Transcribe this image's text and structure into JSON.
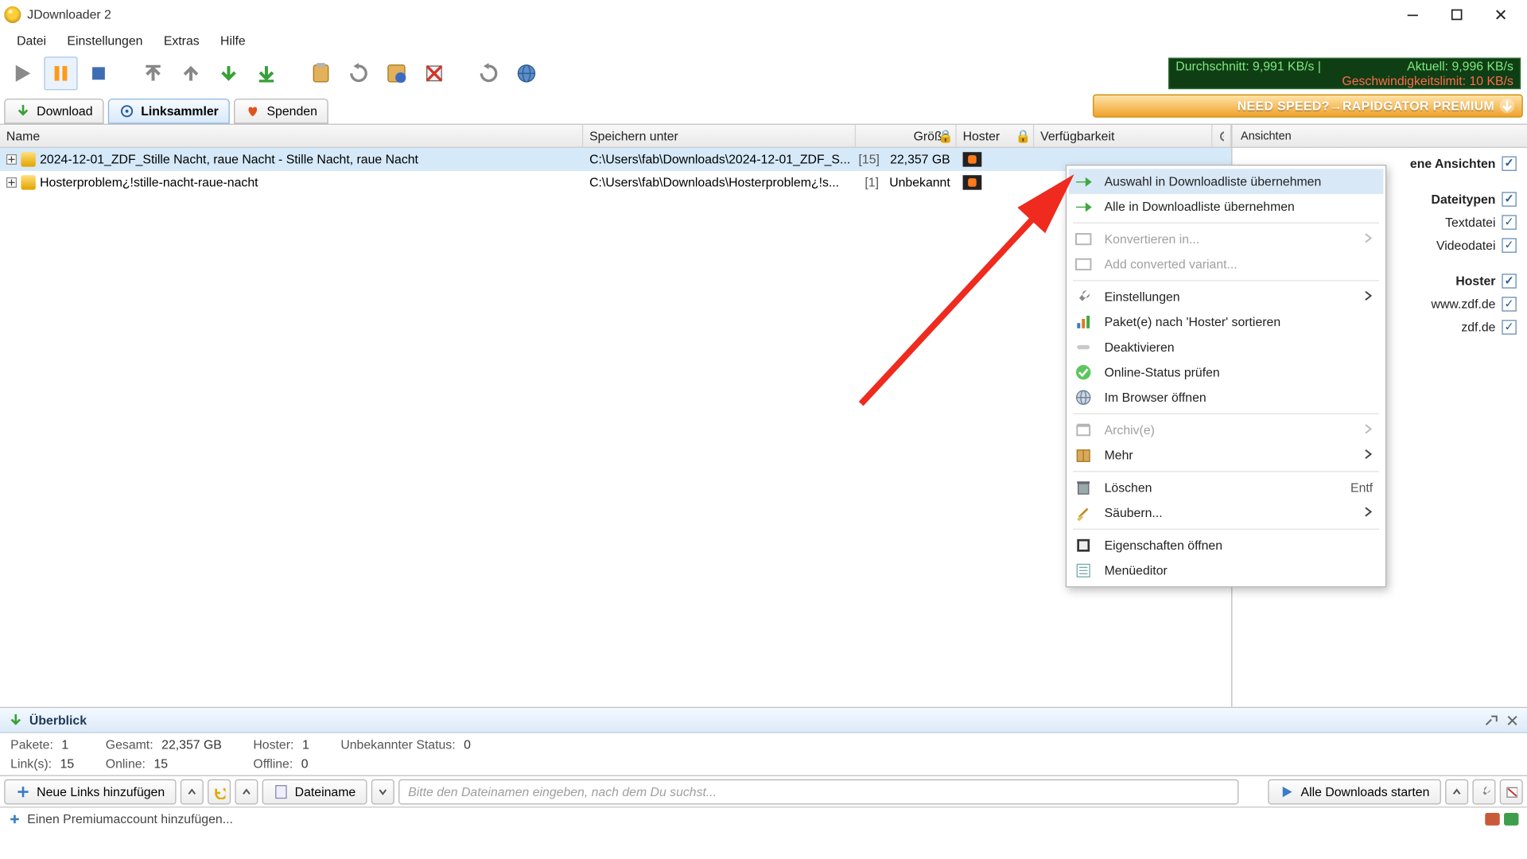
{
  "window": {
    "title": "JDownloader 2"
  },
  "menubar": {
    "file": "Datei",
    "settings": "Einstellungen",
    "extras": "Extras",
    "help": "Hilfe"
  },
  "speed": {
    "avg_label": "Durchschnitt:",
    "avg_value": "9,991 KB/s |",
    "cur_label": "Aktuell:",
    "cur_value": "9,996 KB/s",
    "limit_label": "Geschwindigkeitslimit:",
    "limit_value": "10 KB/s"
  },
  "tabs": {
    "download": "Download",
    "linkgrabber": "Linksammler",
    "donate": "Spenden"
  },
  "banner": "NEED SPEED?→RAPIDGATOR PREMIUM",
  "columns": {
    "name": "Name",
    "save": "Speichern unter",
    "size": "Größe",
    "hoster": "Hoster",
    "avail": "Verfügbarkeit"
  },
  "rows": [
    {
      "name": "2024-12-01_ZDF_Stille Nacht, raue Nacht - Stille Nacht, raue Nacht",
      "save": "C:\\Users\\fab\\Downloads\\2024-12-01_ZDF_S...",
      "count": "[15]",
      "size": "22,357 GB"
    },
    {
      "name": "Hosterproblem¿!stille-nacht-raue-nacht",
      "save": "C:\\Users\\fab\\Downloads\\Hosterproblem¿!s...",
      "count": "[1]",
      "size": "Unbekannt"
    }
  ],
  "sidebar": {
    "header": "Ansichten",
    "own_views": "ene Ansichten",
    "file_types": "Dateitypen",
    "ft": [
      "Textdatei",
      "Videodatei"
    ],
    "hoster_head": "Hoster",
    "hosters": [
      "www.zdf.de",
      "zdf.de"
    ]
  },
  "ctx": [
    {
      "t": "item",
      "label": "Auswahl in Downloadliste übernehmen",
      "icon": "green-arrow",
      "hover": true
    },
    {
      "t": "item",
      "label": "Alle in Downloadliste übernehmen",
      "icon": "green-arrow"
    },
    {
      "t": "sep"
    },
    {
      "t": "item",
      "label": "Konvertieren in...",
      "icon": "convert",
      "disabled": true,
      "sub": true
    },
    {
      "t": "item",
      "label": "Add converted variant...",
      "icon": "convert",
      "disabled": true
    },
    {
      "t": "sep"
    },
    {
      "t": "item",
      "label": "Einstellungen",
      "icon": "wrench",
      "sub": true
    },
    {
      "t": "item",
      "label": "Paket(e) nach 'Hoster' sortieren",
      "icon": "bars"
    },
    {
      "t": "item",
      "label": "Deaktivieren",
      "icon": "disable"
    },
    {
      "t": "item",
      "label": "Online-Status prüfen",
      "icon": "check"
    },
    {
      "t": "item",
      "label": "Im Browser öffnen",
      "icon": "globe"
    },
    {
      "t": "sep"
    },
    {
      "t": "item",
      "label": "Archiv(e)",
      "icon": "archive",
      "disabled": true,
      "sub": true
    },
    {
      "t": "item",
      "label": "Mehr",
      "icon": "package",
      "sub": true
    },
    {
      "t": "sep"
    },
    {
      "t": "item",
      "label": "Löschen",
      "icon": "trash",
      "kbd": "Entf"
    },
    {
      "t": "item",
      "label": "Säubern...",
      "icon": "broom",
      "sub": true
    },
    {
      "t": "sep"
    },
    {
      "t": "item",
      "label": "Eigenschaften öffnen",
      "icon": "properties"
    },
    {
      "t": "item",
      "label": "Menüeditor",
      "icon": "menueditor"
    }
  ],
  "overview": {
    "title": "Überblick",
    "labels": {
      "pakete": "Pakete:",
      "gesamt": "Gesamt:",
      "hoster": "Hoster:",
      "unknown": "Unbekannter Status:",
      "links": "Link(s):",
      "online": "Online:",
      "offline": "Offline:"
    },
    "values": {
      "pakete": "1",
      "gesamt": "22,357 GB",
      "hoster": "1",
      "unknown": "0",
      "links": "15",
      "online": "15",
      "offline": "0"
    }
  },
  "bottom": {
    "add_links": "Neue Links hinzufügen",
    "filename": "Dateiname",
    "search_placeholder": "Bitte den Dateinamen eingeben, nach dem Du suchst...",
    "start_all": "Alle Downloads starten"
  },
  "status": {
    "add_premium": "Einen Premiumaccount hinzufügen..."
  }
}
